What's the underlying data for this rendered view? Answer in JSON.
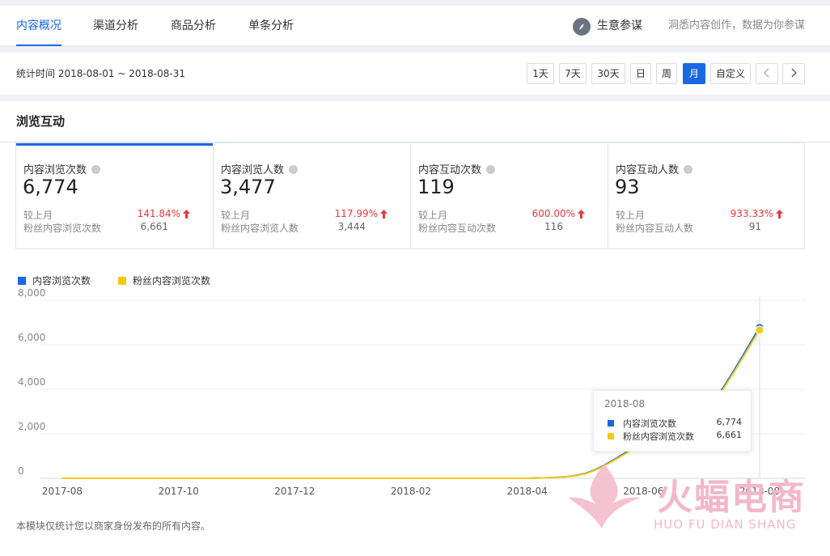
{
  "nav": {
    "tabs": [
      {
        "label": "内容概况",
        "active": true
      },
      {
        "label": "渠道分析",
        "active": false
      },
      {
        "label": "商品分析",
        "active": false
      },
      {
        "label": "单条分析",
        "active": false
      }
    ],
    "brand_title": "生意参谋",
    "brand_subtitle": "洞悉内容创作，数据为你参谋",
    "brand_icon": "compass-icon"
  },
  "timebar": {
    "period": "统计时间 2018-08-01 ~ 2018-08-31",
    "buttons": [
      "1天",
      "7天",
      "30天",
      "日",
      "周",
      "月",
      "自定义"
    ],
    "active_button": "月",
    "prev_icon": "chevron-left-icon",
    "next_icon": "chevron-right-icon"
  },
  "section": {
    "title": "浏览互动"
  },
  "cards": [
    {
      "label": "内容浏览次数",
      "value": "6,774",
      "compare_label": "较上月",
      "compare_value": "141.84%",
      "fans_label": "粉丝内容浏览次数",
      "fans_value": "6,661"
    },
    {
      "label": "内容浏览人数",
      "value": "3,477",
      "compare_label": "较上月",
      "compare_value": "117.99%",
      "fans_label": "粉丝内容浏览人数",
      "fans_value": "3,444"
    },
    {
      "label": "内容互动次数",
      "value": "119",
      "compare_label": "较上月",
      "compare_value": "600.00%",
      "fans_label": "粉丝内容互动次数",
      "fans_value": "116"
    },
    {
      "label": "内容互动人数",
      "value": "93",
      "compare_label": "较上月",
      "compare_value": "933.33%",
      "fans_label": "粉丝内容互动人数",
      "fans_value": "91"
    }
  ],
  "colors": {
    "accent": "#1a68e2",
    "series1": "#1a68e2",
    "series2": "#f5cb13",
    "up": "#e8393c"
  },
  "chart_data": {
    "type": "line",
    "x": [
      "2017-08",
      "2017-09",
      "2017-10",
      "2017-11",
      "2017-12",
      "2018-01",
      "2018-02",
      "2018-03",
      "2018-04",
      "2018-05",
      "2018-06",
      "2018-07",
      "2018-08"
    ],
    "x_tick_labels": [
      "2017-08",
      "2017-10",
      "2017-12",
      "2018-02",
      "2018-04",
      "2018-06",
      "2018-08"
    ],
    "y_tick_labels": [
      "0",
      "2,000",
      "4,000",
      "6,000",
      "8,000"
    ],
    "ylim": [
      0,
      8000
    ],
    "grid": true,
    "legend_position": "top-left",
    "series": [
      {
        "name": "内容浏览次数",
        "values": [
          0,
          0,
          0,
          0,
          0,
          0,
          0,
          0,
          0,
          220,
          1600,
          2800,
          6774
        ]
      },
      {
        "name": "粉丝内容浏览次数",
        "values": [
          0,
          0,
          0,
          0,
          0,
          0,
          0,
          0,
          0,
          200,
          1550,
          2750,
          6661
        ]
      }
    ],
    "tooltip": {
      "title": "2018-08",
      "rows": [
        {
          "name": "内容浏览次数",
          "value": "6,774"
        },
        {
          "name": "粉丝内容浏览次数",
          "value": "6,661"
        }
      ]
    }
  },
  "footnote": "本模块仅统计您以商家身份发布的所有内容。",
  "watermark": {
    "text": "火蝠电商",
    "subtext": "HUO FU DIAN SHANG"
  }
}
